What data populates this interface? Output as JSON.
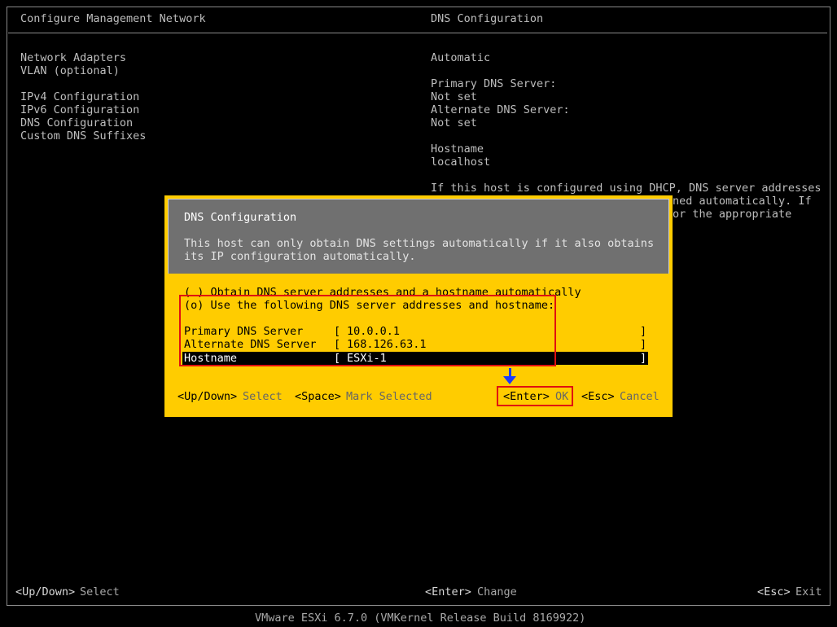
{
  "left_panel": {
    "title": "Configure Management Network",
    "menu": [
      "Network Adapters",
      "VLAN (optional)",
      "IPv4 Configuration",
      "IPv6 Configuration",
      "DNS Configuration",
      "Custom DNS Suffixes"
    ]
  },
  "right_panel": {
    "title": "DNS Configuration",
    "mode": "Automatic",
    "primary_label": "Primary DNS Server:",
    "primary_value": "Not set",
    "alternate_label": "Alternate DNS Server:",
    "alternate_value": "Not set",
    "hostname_label": "Hostname",
    "hostname_value": "localhost",
    "help_line1": "If this host is configured using DHCP, DNS server addresses",
    "help_line2": "ned automatically. If",
    "help_line3": "or the appropriate"
  },
  "dialog": {
    "title": "DNS Configuration",
    "desc_line1": "This host can only obtain DNS settings automatically if it also obtains",
    "desc_line2": "its IP configuration automatically.",
    "option_auto": "( ) Obtain DNS server addresses and a hostname automatically",
    "option_manual": "(o) Use the following DNS server addresses and hostname:",
    "fields": [
      {
        "label": "Primary DNS Server",
        "value": "10.0.0.1"
      },
      {
        "label": "Alternate DNS Server",
        "value": "168.126.63.1"
      },
      {
        "label": "Hostname",
        "value": "ESXi-1"
      }
    ],
    "footer": {
      "updown_key": "<Up/Down>",
      "updown_action": "Select",
      "space_key": "<Space>",
      "space_action": "Mark Selected",
      "enter_key": "<Enter>",
      "enter_action": "OK",
      "esc_key": "<Esc>",
      "esc_action": "Cancel"
    }
  },
  "bottom_bar": {
    "left_key": "<Up/Down>",
    "left_action": "Select",
    "mid_key": "<Enter>",
    "mid_action": "Change",
    "right_key": "<Esc>",
    "right_action": "Exit"
  },
  "status": "VMware ESXi 6.7.0 (VMKernel Release Build 8169922)",
  "colors": {
    "dialog_bg": "#ffcc00",
    "dialog_header": "#707070",
    "highlight": "#e01010",
    "arrow": "#1a3aff"
  }
}
